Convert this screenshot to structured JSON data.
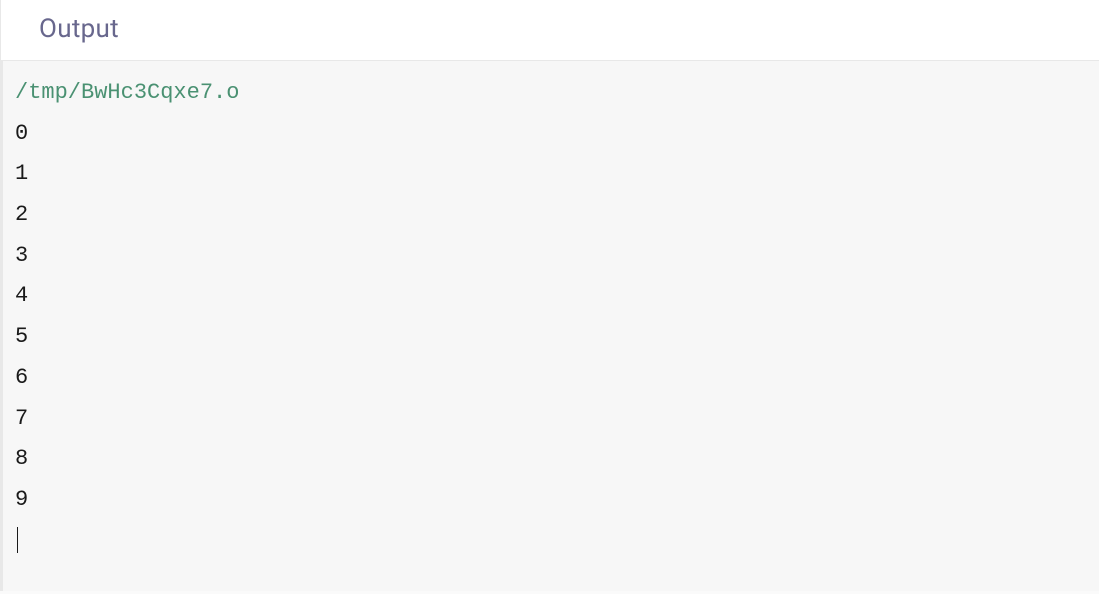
{
  "header": {
    "title": "Output"
  },
  "output": {
    "path": "/tmp/BwHc3Cqxe7.o",
    "lines": [
      "0",
      "1",
      "2",
      "3",
      "4",
      "5",
      "6",
      "7",
      "8",
      "9"
    ]
  }
}
